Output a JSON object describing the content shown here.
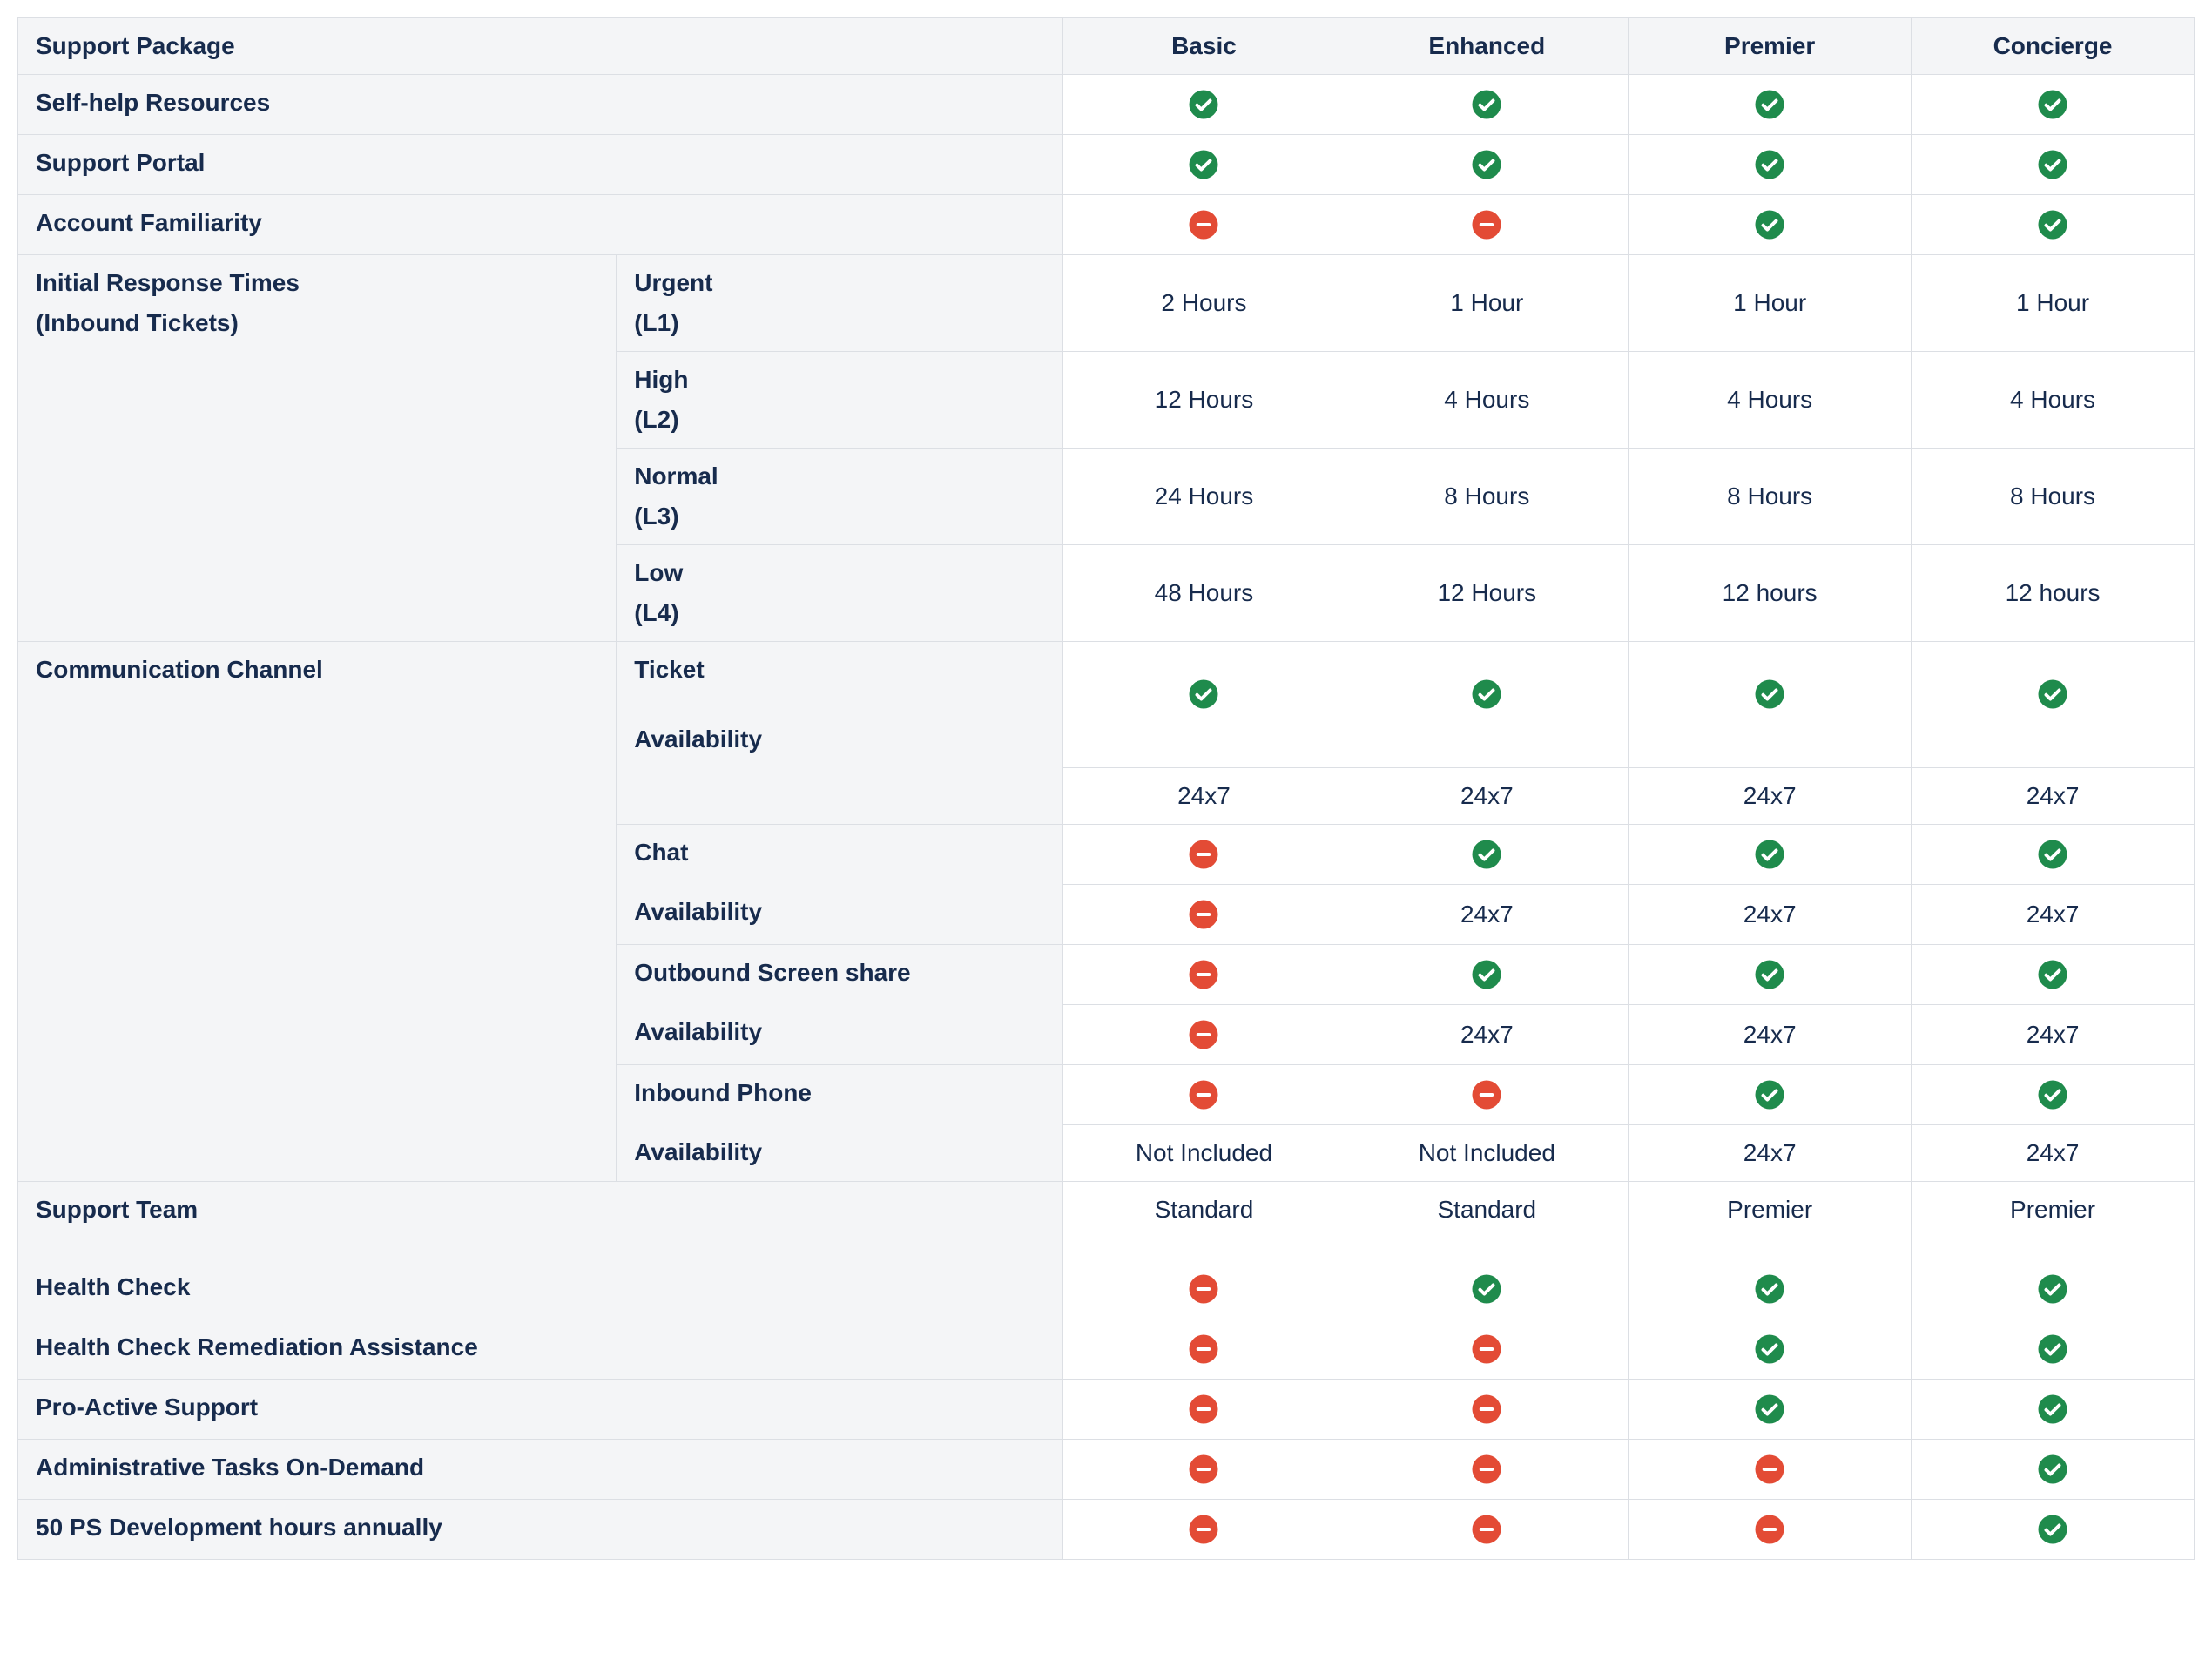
{
  "header": {
    "feature_col": "Support Package",
    "plans": [
      "Basic",
      "Enhanced",
      "Premier",
      "Concierge"
    ]
  },
  "chart_data": {
    "type": "table",
    "title": "Support Package",
    "columns": [
      "Basic",
      "Enhanced",
      "Premier",
      "Concierge"
    ],
    "rows": [
      {
        "feature": "Self-help Resources",
        "values": [
          "yes",
          "yes",
          "yes",
          "yes"
        ]
      },
      {
        "feature": "Support Portal",
        "values": [
          "yes",
          "yes",
          "yes",
          "yes"
        ]
      },
      {
        "feature": "Account Familiarity",
        "values": [
          "no",
          "no",
          "yes",
          "yes"
        ]
      },
      {
        "feature": "Initial Response Times (Inbound Tickets)",
        "sub": "Urgent (L1)",
        "values": [
          "2 Hours",
          "1 Hour",
          "1 Hour",
          "1 Hour"
        ]
      },
      {
        "feature": "Initial Response Times (Inbound Tickets)",
        "sub": "High (L2)",
        "values": [
          "12 Hours",
          "4 Hours",
          "4 Hours",
          "4 Hours"
        ]
      },
      {
        "feature": "Initial Response Times (Inbound Tickets)",
        "sub": "Normal (L3)",
        "values": [
          "24 Hours",
          "8 Hours",
          "8 Hours",
          "8 Hours"
        ]
      },
      {
        "feature": "Initial Response Times (Inbound Tickets)",
        "sub": "Low (L4)",
        "values": [
          "48 Hours",
          "12 Hours",
          "12 hours",
          "12 hours"
        ]
      },
      {
        "feature": "Communication Channel",
        "sub": "Ticket",
        "values": [
          "yes",
          "yes",
          "yes",
          "yes"
        ]
      },
      {
        "feature": "Communication Channel",
        "sub": "Availability",
        "values": [
          "24x7",
          "24x7",
          "24x7",
          "24x7"
        ]
      },
      {
        "feature": "Communication Channel",
        "sub": "Chat",
        "values": [
          "no",
          "yes",
          "yes",
          "yes"
        ]
      },
      {
        "feature": "Communication Channel",
        "sub": "Availability",
        "values": [
          "no",
          "24x7",
          "24x7",
          "24x7"
        ]
      },
      {
        "feature": "Communication Channel",
        "sub": "Outbound Screen share",
        "values": [
          "no",
          "yes",
          "yes",
          "yes"
        ]
      },
      {
        "feature": "Communication Channel",
        "sub": "Availability",
        "values": [
          "no",
          "24x7",
          "24x7",
          "24x7"
        ]
      },
      {
        "feature": "Communication Channel",
        "sub": "Inbound Phone",
        "values": [
          "no",
          "no",
          "yes",
          "yes"
        ]
      },
      {
        "feature": "Communication Channel",
        "sub": "Availability",
        "values": [
          "Not Included",
          "Not Included",
          "24x7",
          "24x7"
        ]
      },
      {
        "feature": "Support Team",
        "values": [
          "Standard",
          "Standard",
          "Premier",
          "Premier"
        ]
      },
      {
        "feature": "Health Check",
        "values": [
          "no",
          "yes",
          "yes",
          "yes"
        ]
      },
      {
        "feature": "Health Check Remediation Assistance",
        "values": [
          "no",
          "no",
          "yes",
          "yes"
        ]
      },
      {
        "feature": "Pro-Active Support",
        "values": [
          "no",
          "no",
          "yes",
          "yes"
        ]
      },
      {
        "feature": "Administrative Tasks On-Demand",
        "values": [
          "no",
          "no",
          "no",
          "yes"
        ]
      },
      {
        "feature": "50 PS Development hours annually",
        "values": [
          "no",
          "no",
          "no",
          "yes"
        ]
      }
    ]
  },
  "labels": {
    "self_help": "Self-help Resources",
    "support_portal": "Support Portal",
    "account_familiarity": "Account Familiarity",
    "irt_line1": "Initial Response Times",
    "irt_line2": "(Inbound Tickets)",
    "urgent_l1_a": "Urgent",
    "urgent_l1_b": "(L1)",
    "high_l2_a": "High",
    "high_l2_b": "(L2)",
    "normal_l3_a": "Normal",
    "normal_l3_b": "(L3)",
    "low_l4_a": "Low",
    "low_l4_b": "(L4)",
    "comm_channel": "Communication Channel",
    "ticket": "Ticket",
    "availability": "Availability",
    "chat": "Chat",
    "outbound_screen": "Outbound Screen share",
    "inbound_phone": "Inbound Phone",
    "support_team": "Support Team",
    "health_check": "Health Check",
    "health_remediation": "Health Check Remediation Assistance",
    "proactive": "Pro-Active Support",
    "admin_tasks": "Administrative Tasks On-Demand",
    "ps_hours": "50 PS Development hours annually"
  },
  "values": {
    "irt": {
      "l1": [
        "2 Hours",
        "1 Hour",
        "1 Hour",
        "1 Hour"
      ],
      "l2": [
        "12 Hours",
        "4 Hours",
        "4 Hours",
        "4 Hours"
      ],
      "l3": [
        "24 Hours",
        "8 Hours",
        "8 Hours",
        "8 Hours"
      ],
      "l4": [
        "48 Hours",
        "12 Hours",
        "12 hours",
        "12 hours"
      ]
    },
    "ticket_avail": [
      "24x7",
      "24x7",
      "24x7",
      "24x7"
    ],
    "chat_avail": [
      "",
      "24x7",
      "24x7",
      "24x7"
    ],
    "screen_avail": [
      "",
      "24x7",
      "24x7",
      "24x7"
    ],
    "phone_avail": [
      "Not Included",
      "Not Included",
      "24x7",
      "24x7"
    ],
    "support_team": [
      "Standard",
      "Standard",
      "Premier",
      "Premier"
    ]
  }
}
